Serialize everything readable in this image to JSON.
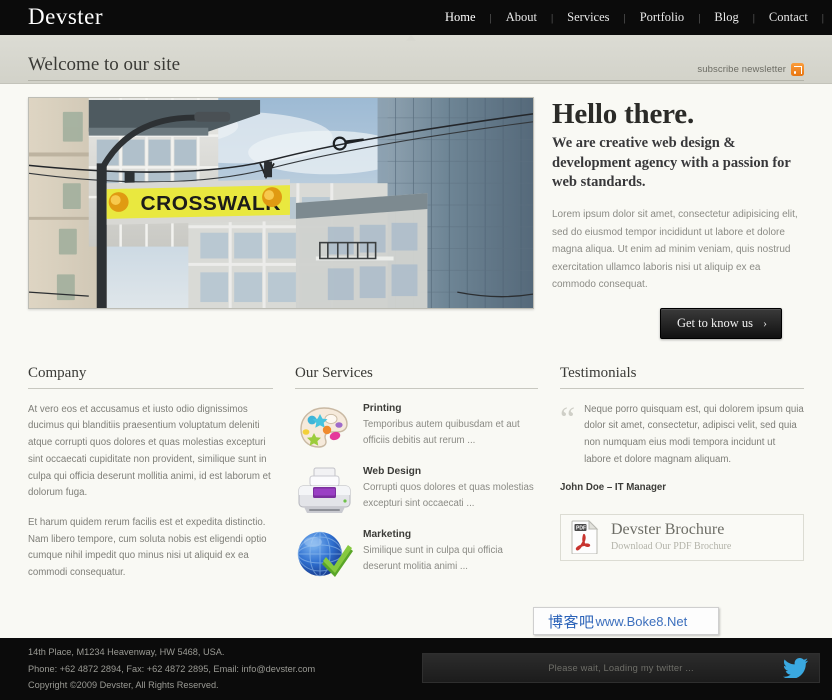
{
  "site": {
    "logo": "Devster"
  },
  "nav": {
    "items": [
      {
        "label": "Home",
        "active": true
      },
      {
        "label": "About",
        "active": false
      },
      {
        "label": "Services",
        "active": false
      },
      {
        "label": "Portfolio",
        "active": false
      },
      {
        "label": "Blog",
        "active": false
      },
      {
        "label": "Contact",
        "active": false
      }
    ],
    "separator": "|"
  },
  "band": {
    "title": "Welcome to our site",
    "subscribe_label": "subscribe newsletter",
    "rss_icon": "rss-icon"
  },
  "hero": {
    "photo_alt": "crosswalk-street-sign-photo",
    "photo_sign_text": "CROSSWALK",
    "heading": "Hello there.",
    "tagline": "We are creative web design & development agency with a passion for web standards.",
    "paragraph": "Lorem ipsum dolor sit amet, consectetur adipisicing elit, sed do eiusmod tempor incididunt ut labore et dolore magna aliqua. Ut enim ad minim veniam, quis nostrud exercitation ullamco laboris nisi ut aliquip ex ea commodo consequat.",
    "button_label": "Get to know us",
    "button_chevron": "›"
  },
  "company": {
    "heading": "Company",
    "paragraphs": [
      "At vero eos et accusamus et iusto odio dignissimos ducimus qui blanditiis praesentium voluptatum deleniti atque corrupti quos dolores et quas molestias excepturi sint occaecati cupiditate non provident, similique sunt in culpa qui officia deserunt mollitia animi, id est laborum et dolorum fuga.",
      "Et harum quidem rerum facilis est et expedita distinctio. Nam libero tempore, cum soluta nobis est eligendi optio cumque nihil impedit quo minus nisi ut aliquid ex ea commodi consequatur."
    ]
  },
  "services": {
    "heading": "Our Services",
    "items": [
      {
        "icon": "paint-palette-icon",
        "title": "Printing",
        "desc": "Temporibus autem quibusdam et aut officiis debitis aut rerum ..."
      },
      {
        "icon": "printer-icon",
        "title": "Web Design",
        "desc": "Corrupti quos dolores et quas molestias excepturi sint occaecati ..."
      },
      {
        "icon": "globe-check-icon",
        "title": "Marketing",
        "desc": "Similique sunt in culpa qui officia deserunt molitia animi ..."
      }
    ]
  },
  "testimonials": {
    "heading": "Testimonials",
    "quote_mark": "“",
    "quote": "Neque porro quisquam est, qui dolorem ipsum quia dolor sit amet, consectetur, adipisci velit, sed quia non numquam eius modi tempora incidunt ut labore et dolore magnam aliquam.",
    "author": "John Doe – IT Manager",
    "brochure": {
      "icon": "pdf-file-icon",
      "title": "Devster Brochure",
      "subtitle": "Download Our PDF Brochure"
    }
  },
  "watermark": {
    "cn": "博客吧",
    "en": "www.Boke8.Net"
  },
  "footer": {
    "address": "14th Place, M1234 Heavenway, HW 5468, USA.",
    "contact": "Phone: +62 4872 2894, Fax: +62 4872 2895, Email: info@devster.com",
    "copyright": "Copyright ©2009 Devster, All Rights Reserved.",
    "twitter_status": "Please wait, Loading my twitter ...",
    "twitter_icon": "twitter-bird-icon"
  },
  "colors": {
    "dark_bar": "#0b0b0b",
    "band": "#d8d8d0",
    "page_bg": "#f9f9f4",
    "rss_orange": "#e87511",
    "twitter_blue": "#3aa8e0",
    "link_blue": "#2a62b8"
  }
}
